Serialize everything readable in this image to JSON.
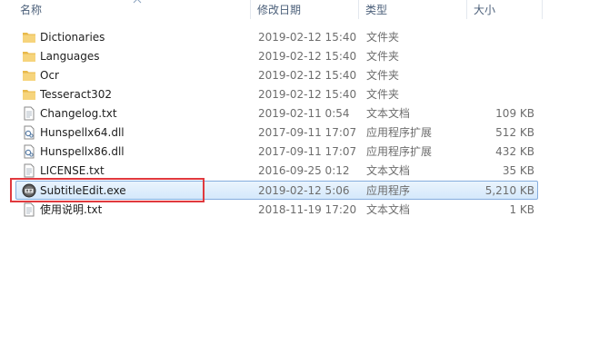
{
  "columns": {
    "name": "名称",
    "date": "修改日期",
    "type": "类型",
    "size": "大小"
  },
  "files": [
    {
      "name": "Dictionaries",
      "date": "2019-02-12 15:40",
      "type": "文件夹",
      "size": "",
      "icon": "folder-icon"
    },
    {
      "name": "Languages",
      "date": "2019-02-12 15:40",
      "type": "文件夹",
      "size": "",
      "icon": "folder-icon"
    },
    {
      "name": "Ocr",
      "date": "2019-02-12 15:40",
      "type": "文件夹",
      "size": "",
      "icon": "folder-icon"
    },
    {
      "name": "Tesseract302",
      "date": "2019-02-12 15:40",
      "type": "文件夹",
      "size": "",
      "icon": "folder-icon"
    },
    {
      "name": "Changelog.txt",
      "date": "2019-02-11 0:54",
      "type": "文本文档",
      "size": "109 KB",
      "icon": "text-file-icon"
    },
    {
      "name": "Hunspellx64.dll",
      "date": "2017-09-11 17:07",
      "type": "应用程序扩展",
      "size": "512 KB",
      "icon": "dll-file-icon"
    },
    {
      "name": "Hunspellx86.dll",
      "date": "2017-09-11 17:07",
      "type": "应用程序扩展",
      "size": "432 KB",
      "icon": "dll-file-icon"
    },
    {
      "name": "LICENSE.txt",
      "date": "2016-09-25 0:12",
      "type": "文本文档",
      "size": "35 KB",
      "icon": "text-file-icon"
    },
    {
      "name": "SubtitleEdit.exe",
      "date": "2019-02-12 5:06",
      "type": "应用程序",
      "size": "5,210 KB",
      "icon": "subtitle-edit-app-icon",
      "selected": true
    },
    {
      "name": "使用说明.txt",
      "date": "2018-11-19 17:20",
      "type": "文本文档",
      "size": "1 KB",
      "icon": "text-file-icon"
    }
  ],
  "colors": {
    "selection_bg": "#d4e8fb",
    "selection_border": "#84acdd",
    "highlight_box": "#e0393e",
    "folder": "#e8b94a"
  }
}
